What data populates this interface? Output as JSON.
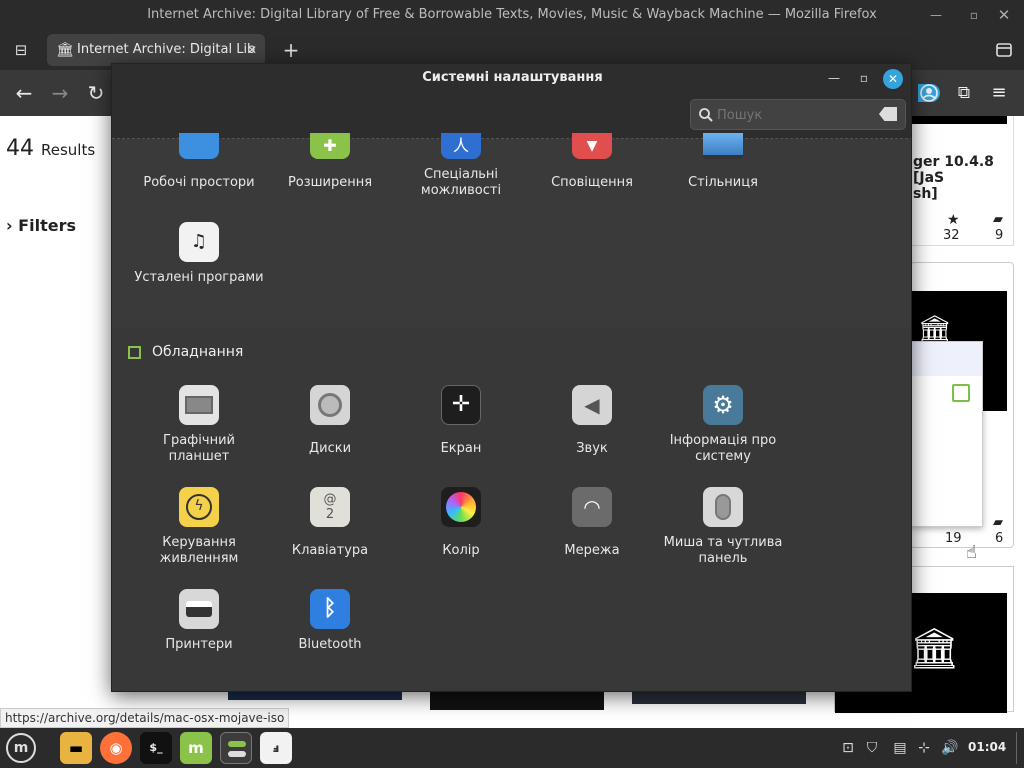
{
  "window": {
    "title": "Internet Archive: Digital Library of Free & Borrowable Texts, Movies, Music & Wayback Machine — Mozilla Firefox"
  },
  "tab": {
    "label": "Internet Archive: Digital Lib"
  },
  "page": {
    "results_count": "44",
    "results_label": "Results",
    "filters_label": "Filters",
    "card_text_line1": "ger 10.4.8 [JaS",
    "card_text_line2": "sh]",
    "card1_favs": "32",
    "card1_reviews": "9",
    "card2_favs": "19",
    "card2_reviews": "6"
  },
  "status_url": "https://archive.org/details/mac-osx-mojave-iso",
  "dialog": {
    "title": "Системні налаштування",
    "search_placeholder": "Пошук",
    "top_row": [
      {
        "label": "Робочі простори",
        "icon": "workspaces-icon"
      },
      {
        "label": "Розширення",
        "icon": "extensions-icon"
      },
      {
        "label": "Спеціальні можливості",
        "icon": "accessibility-icon"
      },
      {
        "label": "Сповіщення",
        "icon": "notifications-icon"
      },
      {
        "label": "Стільниця",
        "icon": "desktop-icon"
      }
    ],
    "preferred_apps": {
      "label": "Усталені програми",
      "icon": "preferred-apps-icon"
    },
    "hardware_section": "Обладнання",
    "hardware": [
      {
        "label": "Графічний планшет",
        "icon": "tablet-icon"
      },
      {
        "label": "Диски",
        "icon": "disks-icon"
      },
      {
        "label": "Екран",
        "icon": "display-icon"
      },
      {
        "label": "Звук",
        "icon": "sound-icon"
      },
      {
        "label": "Інформація про систему",
        "icon": "system-info-icon"
      },
      {
        "label": "Керування живленням",
        "icon": "power-icon"
      },
      {
        "label": "Клавіатура",
        "icon": "keyboard-icon"
      },
      {
        "label": "Колір",
        "icon": "color-icon"
      },
      {
        "label": "Мережа",
        "icon": "network-icon"
      },
      {
        "label": "Миша та чутлива панель",
        "icon": "mouse-icon"
      },
      {
        "label": "Принтери",
        "icon": "printers-icon"
      },
      {
        "label": "Bluetooth",
        "icon": "bluetooth-icon"
      }
    ]
  },
  "taskbar": {
    "clock": "01:04"
  },
  "colors": {
    "accent": "#35a3dc",
    "mint_green": "#8bc34a",
    "dialog_bg": "#3a3a3a",
    "header_bg": "#2d2d2d"
  }
}
